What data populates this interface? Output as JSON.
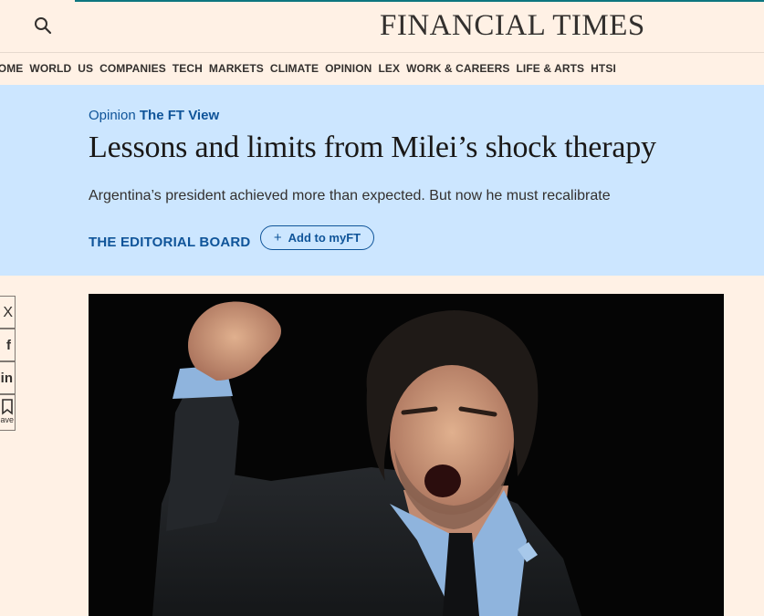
{
  "header": {
    "masthead": "FINANCIAL TIMES",
    "search_icon": "search-icon"
  },
  "nav": {
    "items": [
      "HOME",
      "WORLD",
      "US",
      "COMPANIES",
      "TECH",
      "MARKETS",
      "CLIMATE",
      "OPINION",
      "LEX",
      "WORK & CAREERS",
      "LIFE & ARTS",
      "HTSI"
    ]
  },
  "article": {
    "kicker_section": "Opinion",
    "kicker_series": "The FT View",
    "headline": "Lessons and limits from Milei’s shock therapy",
    "standfirst": "Argentina’s president achieved more than expected. But now he must recalibrate",
    "byline": "THE EDITORIAL BOARD",
    "myft_label": "Add to myFT"
  },
  "share": {
    "items": [
      {
        "icon": "x-icon",
        "glyph": "X"
      },
      {
        "icon": "facebook-icon",
        "glyph": "f"
      },
      {
        "icon": "linkedin-icon",
        "glyph": "in"
      },
      {
        "icon": "bookmark-icon",
        "label": "Save"
      }
    ]
  },
  "image": {
    "description": "photo-man-raised-fist"
  },
  "colors": {
    "page_bg": "#fff1e5",
    "hero_bg": "#cce6ff",
    "link_blue": "#0f5499",
    "teal_line": "#0d7680"
  }
}
